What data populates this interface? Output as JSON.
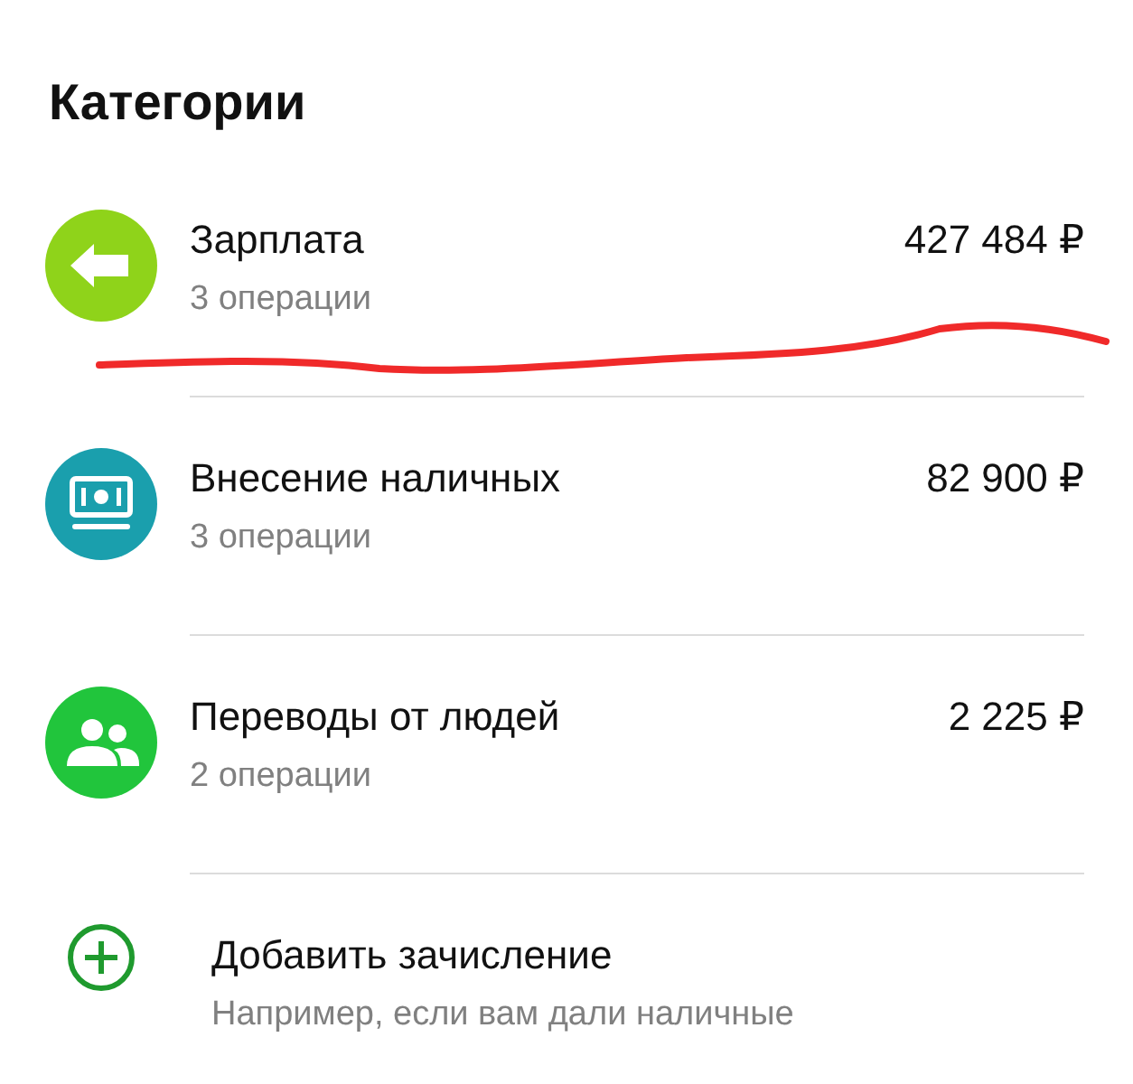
{
  "title": "Категории",
  "categories": [
    {
      "name": "Зарплата",
      "count": "3 операции",
      "amount": "427 484 ₽",
      "kind": "arrow",
      "color": "#8fd31a"
    },
    {
      "name": "Внесение наличных",
      "count": "3 операции",
      "amount": "82 900 ₽",
      "kind": "cash",
      "color": "#1a9fad"
    },
    {
      "name": "Переводы от людей",
      "count": "2 операции",
      "amount": "2 225 ₽",
      "kind": "people",
      "color": "#21c53c"
    }
  ],
  "add": {
    "label": "Добавить зачисление",
    "hint": "Например, если вам дали наличные"
  }
}
